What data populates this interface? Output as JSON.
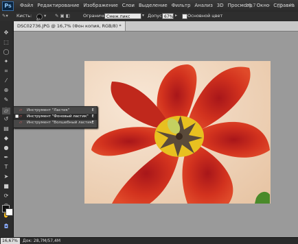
{
  "app": {
    "logo": "Ps",
    "zoom_readout": "16,7",
    "window_controls": [
      "–",
      "□",
      "✕"
    ]
  },
  "menu": [
    "Файл",
    "Редактирование",
    "Изображение",
    "Слои",
    "Выделение",
    "Фильтр",
    "Анализ",
    "3D",
    "Просмотр",
    "Окно",
    "Справка"
  ],
  "options": {
    "brush_label": "Кисть:",
    "brush_size": "47",
    "limits_label": "Ограничения:",
    "limits_value": "Смеж.пикс",
    "tolerance_label": "Допуск:",
    "tolerance_value": "67%",
    "main_color_label": "Основной цвет"
  },
  "document": {
    "tab_title": "DSC02736.JPG @ 16,7% (Фон копия, RGB/8) *"
  },
  "flyout": {
    "items": [
      {
        "label": "Инструмент \"Ластик\"",
        "key": "E"
      },
      {
        "label": "Инструмент \"Фоновый ластик\"",
        "key": "E"
      },
      {
        "label": "Инструмент \"Волшебный ластик\"",
        "key": "E"
      }
    ]
  },
  "status": {
    "zoom": "16,67%",
    "doc_size": "Док: 28,7М/57,4М"
  },
  "colors": {
    "canvas_bg": "#f3d9c1",
    "petal": "#c8281c",
    "center": "#e8c020"
  }
}
